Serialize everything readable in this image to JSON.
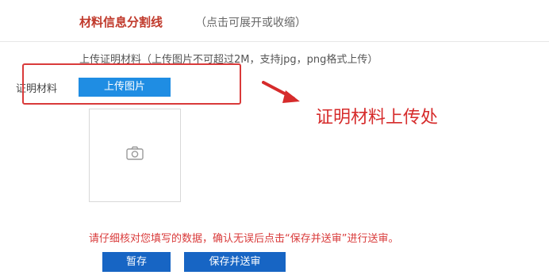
{
  "section": {
    "title": "材料信息分割线",
    "hint": "（点击可展开或收缩）"
  },
  "upload": {
    "note": "上传证明材料（上传图片不可超过2M，支持jpg，png格式上传）",
    "field_label": "证明材料",
    "button_label": "上传图片",
    "placeholder_icon": "camera-icon"
  },
  "annotation": {
    "callout_text": "证明材料上传处",
    "highlight_color": "#d93a3a"
  },
  "footer": {
    "warning": "请仔细核对您填写的数据，确认无误后点击“保存并送审”进行送审。",
    "temp_save_label": "暂存",
    "save_submit_label": "保存并送审"
  },
  "colors": {
    "title_red": "#c0392b",
    "upload_blue": "#1f8de3",
    "button_blue": "#1765c4",
    "warning_red": "#d93a3a"
  }
}
